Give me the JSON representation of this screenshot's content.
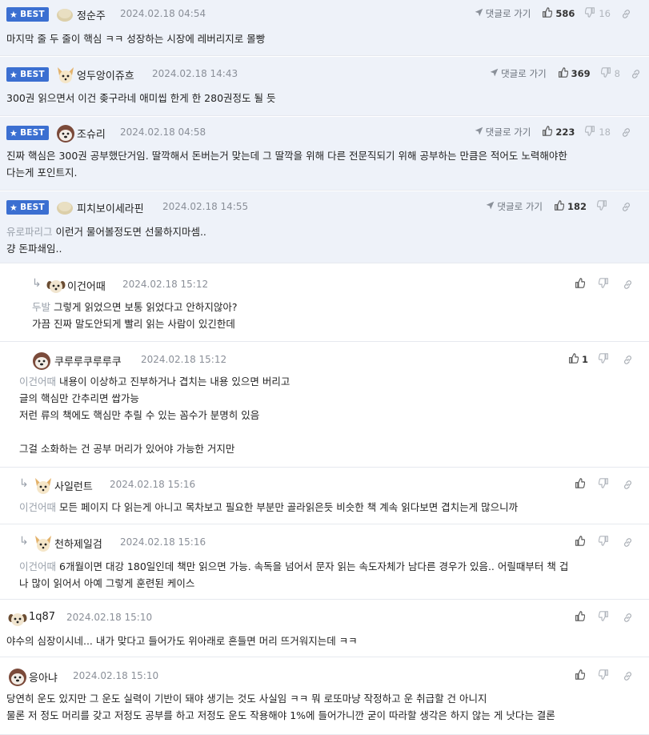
{
  "best_badge": "BEST",
  "goto_label": "댓글로 가기",
  "comments": [
    {
      "nick": "정순주",
      "date": "2024.02.18 04:54",
      "up": "586",
      "down": "16",
      "lines": [
        "마지막 줄 두 줄이 핵심 ㅋㅋ 성장하는 시장에 레버리지로 몰빵"
      ]
    },
    {
      "nick": "엉두앙이쥬흐",
      "date": "2024.02.18 14:43",
      "up": "369",
      "down": "8",
      "lines": [
        "300권 읽으면서 이건 좆구라네 애미씹 한게 한 280권정도 될 듯"
      ]
    },
    {
      "nick": "조슈리",
      "date": "2024.02.18 04:58",
      "up": "223",
      "down": "18",
      "lines": [
        "진짜 핵심은 300권 공부했단거임. 딸깍해서 돈버는거 맞는데 그 딸깍을 위해 다른 전문직되기 위해 공부하는 만큼은 적어도 노력해야한",
        "다는게 포인트지."
      ]
    },
    {
      "nick": "피치보이세라핀",
      "date": "2024.02.18 14:55",
      "up": "182",
      "down": "",
      "mention": "유로파리그",
      "lines": [
        "이런거 물어볼정도면 선물하지마셈..",
        "걍 돈파쇄임.."
      ]
    },
    {
      "nick": "이건어때",
      "date": "2024.02.18 15:12",
      "up": "",
      "down": "",
      "mention": "두발",
      "lines": [
        "그렇게 읽었으면 보통 읽었다고 안하지않아?",
        "가끔 진짜 말도안되게 빨리 읽는 사람이 있긴한데"
      ]
    },
    {
      "nick": "쿠루루쿠루루쿠",
      "date": "2024.02.18 15:12",
      "up": "1",
      "down": "",
      "mention": "이건어때",
      "lines": [
        "내용이 이상하고 진부하거나 겹치는 내용 있으면 버리고",
        "글의 핵심만 간추리면 쌉가능",
        "저런 류의 책에도 핵심만 추릴 수 있는 꼼수가 분명히 있음",
        "",
        "그걸 소화하는 건 공부 머리가 있어야 가능한 거지만"
      ]
    },
    {
      "nick": "사일런트",
      "date": "2024.02.18 15:16",
      "up": "",
      "down": "",
      "mention": "이건어때",
      "lines": [
        "모든 페이지 다 읽는게 아니고 목차보고 필요한 부분만 골라읽은듯 비슷한 책 계속 읽다보면 겹치는게 많으니까"
      ]
    },
    {
      "nick": "천하제일검",
      "date": "2024.02.18 15:16",
      "up": "",
      "down": "",
      "mention": "이건어때",
      "lines": [
        "6개월이면 대강 180일인데 책만 읽으면 가능. 속독을 넘어서 문자 읽는 속도자체가 남다른 경우가 있음.. 어릴때부터 책 겁",
        "나 많이 읽어서 아예 그렇게 훈련된 케이스"
      ]
    },
    {
      "nick": "1q87",
      "date": "2024.02.18 15:10",
      "up": "",
      "down": "",
      "lines": [
        "야수의 심장이시네... 내가 맞다고 들어가도 위아래로 흔들면 머리 뜨거워지는데 ㅋㅋ"
      ]
    },
    {
      "nick": "응아냐",
      "date": "2024.02.18 15:10",
      "up": "",
      "down": "",
      "lines": [
        "당연히 운도 있지만 그 운도 실력이 기반이 돼야 생기는 것도 사실임 ㅋㅋ 뭐 로또마냥 작정하고 운 취급할 건 아니지",
        "물론 저 정도 머리를 갖고 저정도 공부를 하고 저정도 운도 작용해야 1%에 들어가니깐 굳이 따라할 생각은 하지 않는 게 낫다는 결론"
      ]
    }
  ]
}
